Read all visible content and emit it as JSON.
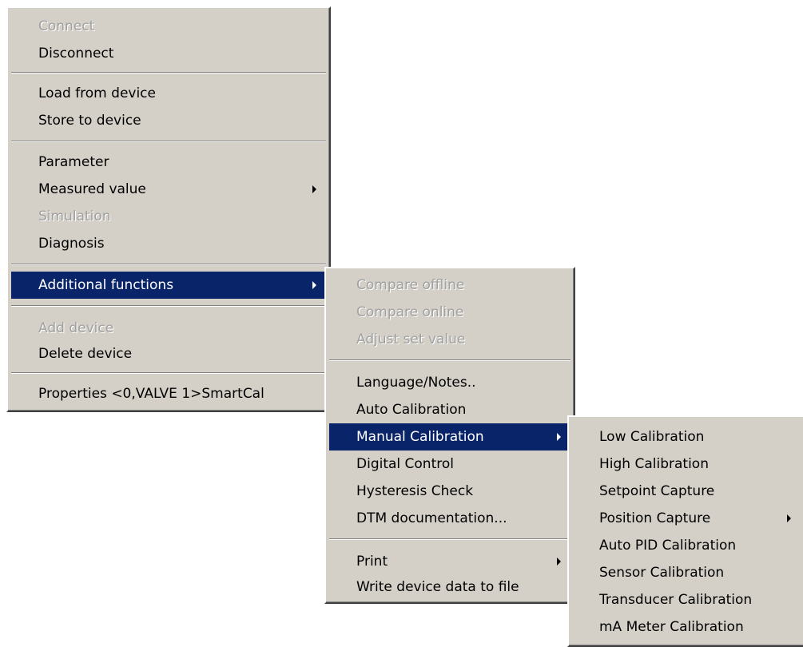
{
  "main_menu": {
    "connect": "Connect",
    "disconnect": "Disconnect",
    "load_from_device": "Load from device",
    "store_to_device": "Store to device",
    "parameter": "Parameter",
    "measured_value": "Measured value",
    "simulation": "Simulation",
    "diagnosis": "Diagnosis",
    "additional_functions": "Additional functions",
    "add_device": "Add device",
    "delete_device": "Delete device",
    "properties": "Properties <0,VALVE 1>SmartCal"
  },
  "additional_menu": {
    "compare_offline": "Compare offline",
    "compare_online": "Compare online",
    "adjust_set_value": "Adjust set value",
    "language_notes": "Language/Notes..",
    "auto_calibration": "Auto Calibration",
    "manual_calibration": "Manual Calibration",
    "digital_control": "Digital Control",
    "hysteresis_check": "Hysteresis Check",
    "dtm_documentation": "DTM documentation...",
    "print": "Print",
    "write_device_data": "Write device data to file"
  },
  "manual_menu": {
    "low_calibration": "Low Calibration",
    "high_calibration": "High Calibration",
    "setpoint_capture": "Setpoint Capture",
    "position_capture": "Position Capture",
    "auto_pid_calibration": "Auto PID Calibration",
    "sensor_calibration": "Sensor Calibration",
    "transducer_calibration": "Transducer Calibration",
    "ma_meter_calibration": "mA Meter Calibration"
  },
  "colors": {
    "menu_bg": "#d4d0c8",
    "highlight": "#0a246a",
    "disabled_text": "#a0a0a0"
  }
}
